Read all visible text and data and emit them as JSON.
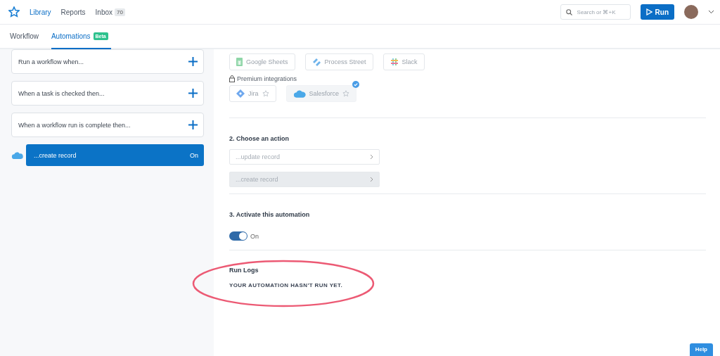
{
  "nav": {
    "links": [
      {
        "label": "Library",
        "selected": true
      },
      {
        "label": "Reports",
        "selected": false
      },
      {
        "label": "Inbox",
        "selected": false,
        "count": "70"
      }
    ],
    "search": {
      "placeholder": "Search or ⌘+K"
    },
    "run_button": "Run"
  },
  "tabs": [
    {
      "label": "Workflow",
      "selected": false
    },
    {
      "label": "Automations",
      "selected": true,
      "badge": "Beta"
    }
  ],
  "sidebar": {
    "triggers": [
      "Run a workflow when...",
      "When a task is checked then...",
      "When a workflow run is complete then..."
    ],
    "automation": {
      "label": "...create record",
      "status": "On",
      "on": true
    }
  },
  "integrations": {
    "apps": [
      {
        "kind": "sheets",
        "label": "Google Sheets",
        "selected": false
      },
      {
        "kind": "process",
        "label": "Process Street",
        "selected": false
      },
      {
        "kind": "slack",
        "label": "Slack",
        "selected": false
      }
    ],
    "premium_label": "Premium integrations",
    "premium": [
      {
        "kind": "jira",
        "label": "Jira",
        "selected": false
      },
      {
        "kind": "salesforce",
        "label": "Salesforce",
        "selected": true
      }
    ]
  },
  "action_section": {
    "title": "2. Choose an action",
    "actions": [
      {
        "label": "...update record",
        "selected": false
      },
      {
        "label": "...create record",
        "selected": true
      }
    ]
  },
  "activate_section": {
    "title": "3. Activate this automation",
    "toggle_on": true,
    "toggle_label": "On"
  },
  "run_logs": {
    "title": "Run Logs",
    "message": "YOUR AUTOMATION HASN'T RUN YET."
  },
  "help_button": "Help"
}
